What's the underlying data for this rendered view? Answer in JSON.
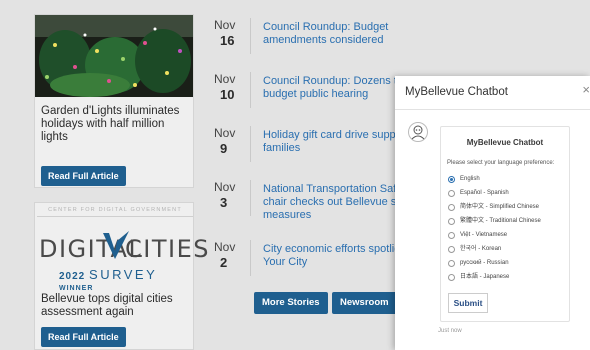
{
  "cards": [
    {
      "title": "Garden d'Lights illuminates holidays with half million lights",
      "button": "Read Full Article"
    },
    {
      "badge_top": "CENTER FOR DIGITAL GOVERNMENT",
      "badge_word1": "DIGITAL",
      "badge_word2": "CITIES",
      "badge_year": "2022",
      "badge_survey": "SURVEY",
      "badge_winner": "WINNER",
      "title": "Bellevue tops digital cities assessment again",
      "button": "Read Full Article"
    }
  ],
  "news": [
    {
      "month": "Nov",
      "day": "16",
      "headline": "Council Roundup: Budget amendments considered"
    },
    {
      "month": "Nov",
      "day": "10",
      "headline": "Council Roundup: Dozens turn out for budget public hearing"
    },
    {
      "month": "Nov",
      "day": "9",
      "headline": "Holiday gift card drive supports local families"
    },
    {
      "month": "Nov",
      "day": "3",
      "headline": "National Transportation Safety Board chair checks out Bellevue street safety measures"
    },
    {
      "month": "Nov",
      "day": "2",
      "headline": "City economic efforts spotlighted in It's Your City"
    }
  ],
  "buttons": {
    "more_stories": "More Stories",
    "newsroom": "Newsroom"
  },
  "chat": {
    "window_title": "MyBellevue Chatbot",
    "close": "×",
    "bubble_title": "MyBellevue Chatbot",
    "prompt": "Please select your language preference:",
    "options": [
      "English",
      "Español - Spanish",
      "简体中文 - Simplified Chinese",
      "繁體中文 - Traditional Chinese",
      "Việt - Vietnamese",
      "한국어 - Korean",
      "русский - Russian",
      "日本語 - Japanese"
    ],
    "selected_index": 0,
    "submit": "Submit",
    "timestamp": "Just now"
  },
  "colors": {
    "accent": "#1f5f8f",
    "link": "#2a6fb0"
  }
}
